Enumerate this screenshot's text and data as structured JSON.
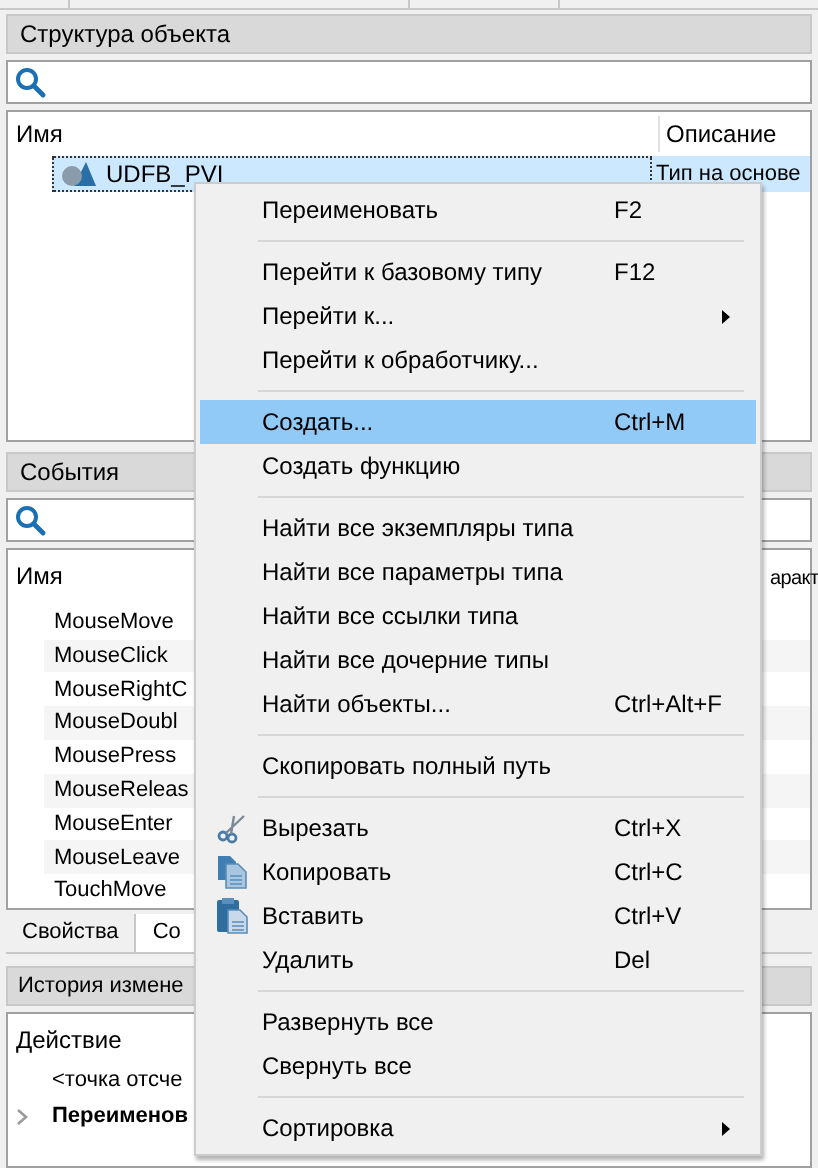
{
  "object_structure": {
    "title": "Структура объекта",
    "columns": [
      "Имя",
      "Описание"
    ],
    "rows": [
      {
        "name": "UDFB_PVI",
        "description": "Тип на основе",
        "selected": true
      }
    ]
  },
  "events": {
    "title": "События",
    "columns": [
      "Имя",
      "аракт"
    ],
    "rows": [
      {
        "name": "MouseMove"
      },
      {
        "name": "MouseClick"
      },
      {
        "name": "MouseRightC"
      },
      {
        "name": "MouseDoubl"
      },
      {
        "name": "MousePress"
      },
      {
        "name": "MouseReleas"
      },
      {
        "name": "MouseEnter"
      },
      {
        "name": "MouseLeave"
      },
      {
        "name": "TouchMove"
      }
    ]
  },
  "tabs": [
    {
      "label": "Свойства",
      "selected": false
    },
    {
      "label": "Со",
      "selected": true
    }
  ],
  "history": {
    "title": "История измене",
    "columns": [
      "Действие"
    ],
    "rows": [
      {
        "text": "<точка отсче",
        "bold": false,
        "expandable": false
      },
      {
        "text": "Переименов",
        "bold": true,
        "expandable": true
      }
    ]
  },
  "context_menu": {
    "items": [
      {
        "kind": "item",
        "label": "Переименовать",
        "shortcut": "F2",
        "submenu": false,
        "selected": false
      },
      {
        "kind": "separator"
      },
      {
        "kind": "item",
        "label": "Перейти к базовому типу",
        "shortcut": "F12",
        "submenu": false,
        "selected": false
      },
      {
        "kind": "item",
        "label": "Перейти к...",
        "submenu": true,
        "selected": false
      },
      {
        "kind": "item",
        "label": "Перейти к обработчику...",
        "submenu": false,
        "selected": false
      },
      {
        "kind": "separator"
      },
      {
        "kind": "item",
        "label": "Создать...",
        "shortcut": "Ctrl+M",
        "submenu": false,
        "selected": true
      },
      {
        "kind": "item",
        "label": "Создать функцию",
        "submenu": false,
        "selected": false
      },
      {
        "kind": "separator"
      },
      {
        "kind": "item",
        "label": "Найти все экземпляры типа",
        "submenu": false,
        "selected": false
      },
      {
        "kind": "item",
        "label": "Найти все параметры типа",
        "submenu": false,
        "selected": false
      },
      {
        "kind": "item",
        "label": "Найти все ссылки типа",
        "submenu": false,
        "selected": false
      },
      {
        "kind": "item",
        "label": "Найти все дочерние типы",
        "submenu": false,
        "selected": false
      },
      {
        "kind": "item",
        "label": "Найти объекты...",
        "shortcut": "Ctrl+Alt+F",
        "submenu": false,
        "selected": false
      },
      {
        "kind": "separator"
      },
      {
        "kind": "item",
        "label": "Скопировать полный путь",
        "submenu": false,
        "selected": false
      },
      {
        "kind": "separator"
      },
      {
        "kind": "cut",
        "label": "Вырезать",
        "shortcut": "Ctrl+X",
        "submenu": false,
        "selected": false
      },
      {
        "kind": "copy",
        "label": "Копировать",
        "shortcut": "Ctrl+C",
        "submenu": false,
        "selected": false
      },
      {
        "kind": "paste",
        "label": "Вставить",
        "shortcut": "Ctrl+V",
        "submenu": false,
        "selected": false
      },
      {
        "kind": "item",
        "label": "Удалить",
        "shortcut": "Del",
        "submenu": false,
        "selected": false
      },
      {
        "kind": "separator"
      },
      {
        "kind": "item",
        "label": "Развернуть все",
        "submenu": false,
        "selected": false
      },
      {
        "kind": "item",
        "label": "Свернуть все",
        "submenu": false,
        "selected": false
      },
      {
        "kind": "separator"
      },
      {
        "kind": "item",
        "label": "Сортировка",
        "submenu": true,
        "selected": false
      }
    ]
  }
}
